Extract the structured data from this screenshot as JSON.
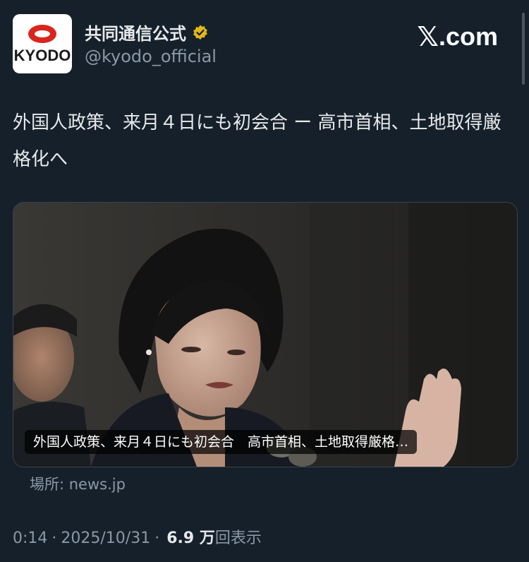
{
  "author": {
    "display_name": "共同通信公式",
    "handle": "@kyodo_official",
    "avatar_text": "KYODO",
    "verified_icon": "verified-badge-icon"
  },
  "brand": {
    "x": "𝕏",
    "domain": ".com"
  },
  "tweet": {
    "text": "外国人政策、来月４日にも初会合 ー 高市首相、土地取得厳格化へ"
  },
  "card": {
    "caption": "外国人政策、来月４日にも初会合　高市首相、土地取得厳格…",
    "source_label": "場所: news.jp"
  },
  "meta": {
    "time": "0:14",
    "separator": "·",
    "date": "2025/10/31",
    "views_count": "6.9 万",
    "views_label": "回表示"
  },
  "colors": {
    "background": "#15202b",
    "text_primary": "#e7e9ea",
    "text_secondary": "#8b98a5",
    "verified": "#e2b719",
    "logo_red": "#d9251d"
  }
}
